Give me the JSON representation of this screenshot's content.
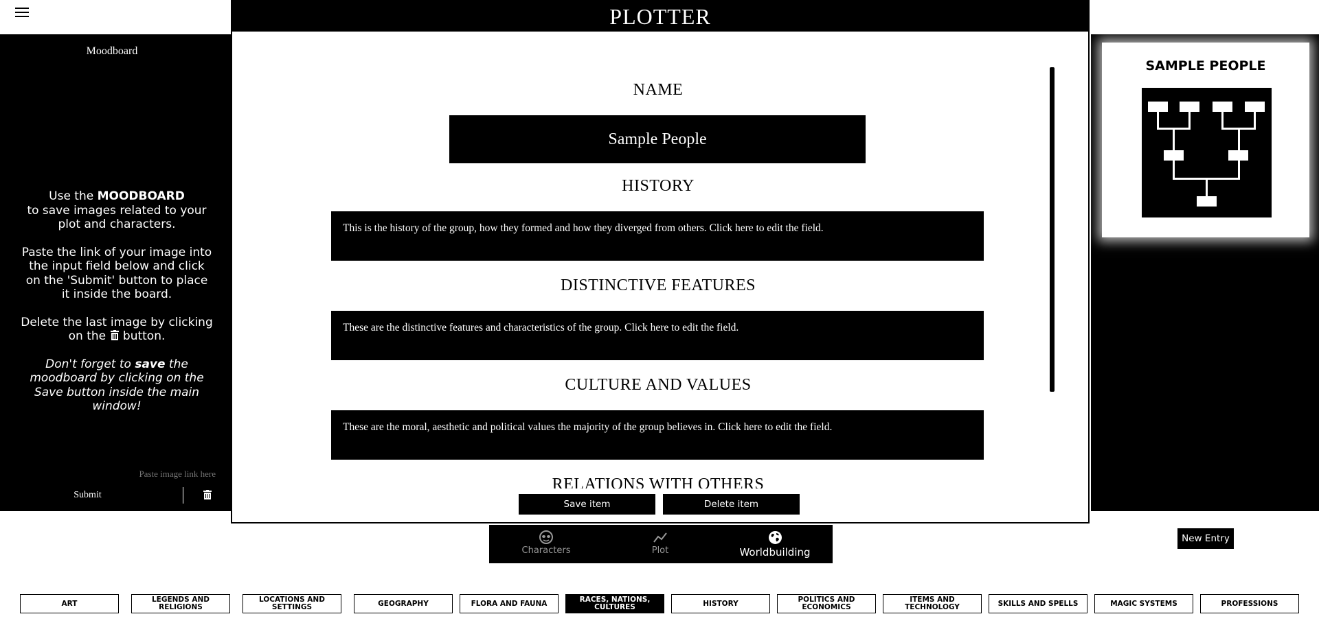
{
  "app": {
    "title": "PLOTTER"
  },
  "moodboard": {
    "title": "Moodboard",
    "instr1": [
      "Use the ",
      "MOODBOARD",
      " to save images related to your plot and characters."
    ],
    "instr2": "Paste the link of your image into the input field below and click on the 'Submit' button to place it inside the board.",
    "instr3": [
      "Delete the last image by clicking on the ",
      " button."
    ],
    "instr4": [
      "Don't forget to ",
      "save",
      " the moodboard by clicking on the Save button inside the main window!"
    ],
    "input_placeholder": "Paste image link here",
    "submit_label": "Submit"
  },
  "entry": {
    "sections": [
      {
        "title": "NAME",
        "value": "Sample People"
      },
      {
        "title": "HISTORY",
        "value": "This is the history of the group, how they formed and how they diverged from others. Click here to edit the field."
      },
      {
        "title": "DISTINCTIVE FEATURES",
        "value": "These are the distinctive features and characteristics of the group. Click here to edit the field."
      },
      {
        "title": "CULTURE AND VALUES",
        "value": "These are the moral, aesthetic and political values the majority of the group believes in. Click here to edit the field."
      },
      {
        "title": "RELATIONS WITH OTHERS"
      }
    ],
    "save_label": "Save item",
    "delete_label": "Delete item"
  },
  "preview": {
    "title": "SAMPLE PEOPLE"
  },
  "nav": {
    "items": [
      {
        "label": "Characters",
        "icon": "mask-icon"
      },
      {
        "label": "Plot",
        "icon": "chart-line-icon"
      },
      {
        "label": "Worldbuilding",
        "icon": "globe-icon"
      }
    ],
    "active": "Worldbuilding"
  },
  "new_entry_label": "New Entry",
  "categories": {
    "items": [
      "ART",
      "LEGENDS AND RELIGIONS",
      "LOCATIONS AND SETTINGS",
      "GEOGRAPHY",
      "FLORA AND FAUNA",
      "RACES, NATIONS, CULTURES",
      "HISTORY",
      "POLITICS AND ECONOMICS",
      "ITEMS AND TECHNOLOGY",
      "SKILLS AND SPELLS",
      "MAGIC SYSTEMS",
      "PROFESSIONS"
    ],
    "active": "RACES, NATIONS, CULTURES"
  },
  "colors": {
    "primary": "#000000",
    "background": "#ffffff",
    "muted": "#999999"
  }
}
